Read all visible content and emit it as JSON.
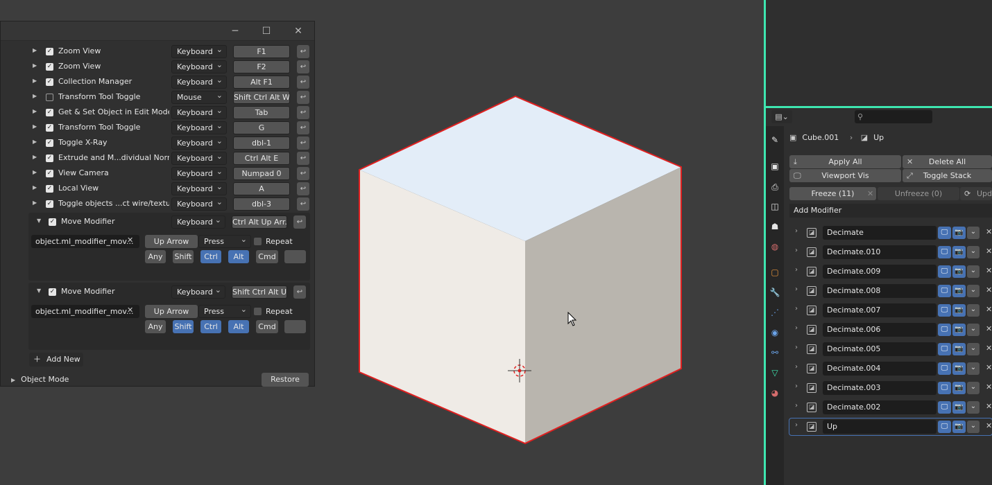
{
  "window": {
    "minimize_icon": "minimize-icon",
    "maximize_icon": "maximize-icon",
    "close_icon": "close-icon"
  },
  "keymap_items": [
    {
      "name": "Zoom View",
      "checked": true,
      "type": "Keyboard",
      "key": "F1"
    },
    {
      "name": "Zoom View",
      "checked": true,
      "type": "Keyboard",
      "key": "F2"
    },
    {
      "name": "Collection Manager",
      "checked": true,
      "type": "Keyboard",
      "key": "Alt F1"
    },
    {
      "name": "Transform Tool Toggle",
      "checked": false,
      "type": "Mouse",
      "key": "Shift Ctrl Alt W..."
    },
    {
      "name": "Get & Set Object in Edit Mode",
      "checked": true,
      "type": "Keyboard",
      "key": "Tab"
    },
    {
      "name": "Transform Tool Toggle",
      "checked": true,
      "type": "Keyboard",
      "key": "G"
    },
    {
      "name": "Toggle X-Ray",
      "checked": true,
      "type": "Keyboard",
      "key": "dbl-1"
    },
    {
      "name": "Extrude and M...dividual Normal",
      "checked": true,
      "type": "Keyboard",
      "key": "Ctrl Alt E"
    },
    {
      "name": "View Camera",
      "checked": true,
      "type": "Keyboard",
      "key": "Numpad 0"
    },
    {
      "name": "Local View",
      "checked": true,
      "type": "Keyboard",
      "key": "A"
    },
    {
      "name": "Toggle objects ...ct wire/textured",
      "checked": true,
      "type": "Keyboard",
      "key": "dbl-3"
    }
  ],
  "expanded_items": [
    {
      "name": "Move Modifier",
      "type": "Keyboard",
      "key": "Ctrl Alt Up Arr...",
      "operator": "object.ml_modifier_mov...",
      "event": "Up Arrow",
      "value": "Press",
      "repeat_label": "Repeat",
      "modifiers": [
        {
          "label": "Any",
          "on": false
        },
        {
          "label": "Shift",
          "on": false
        },
        {
          "label": "Ctrl",
          "on": true
        },
        {
          "label": "Alt",
          "on": true
        },
        {
          "label": "Cmd",
          "on": false
        }
      ]
    },
    {
      "name": "Move Modifier",
      "type": "Keyboard",
      "key": "Shift Ctrl Alt U...",
      "operator": "object.ml_modifier_mov...",
      "event": "Up Arrow",
      "value": "Press",
      "repeat_label": "Repeat",
      "modifiers": [
        {
          "label": "Any",
          "on": false
        },
        {
          "label": "Shift",
          "on": true
        },
        {
          "label": "Ctrl",
          "on": true
        },
        {
          "label": "Alt",
          "on": true
        },
        {
          "label": "Cmd",
          "on": false
        }
      ]
    }
  ],
  "add_new_label": "Add New",
  "object_mode_label": "Object Mode",
  "restore_label": "Restore",
  "properties": {
    "object_name": "Cube.001",
    "modifier_name": "Up",
    "apply_all": "Apply All",
    "delete_all": "Delete All",
    "viewport_vis": "Viewport Vis",
    "toggle_stack": "Toggle Stack",
    "freeze": "Freeze (11)",
    "unfreeze": "Unfreeze (0)",
    "upd": "Upd",
    "add_modifier": "Add Modifier",
    "modifiers": [
      "Decimate",
      "Decimate.010",
      "Decimate.009",
      "Decimate.008",
      "Decimate.007",
      "Decimate.006",
      "Decimate.005",
      "Decimate.004",
      "Decimate.003",
      "Decimate.002",
      "Up"
    ]
  },
  "colors": {
    "accent": "#4772b3",
    "area_highlight": "#3ee6b0",
    "selection_outline": "#e02020"
  }
}
